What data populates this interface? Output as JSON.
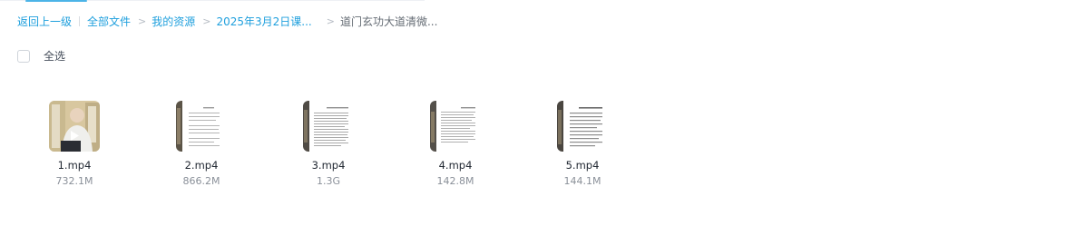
{
  "breadcrumb": {
    "back": "返回上一级",
    "items": [
      "全部文件",
      "我的资源",
      "2025年3月2日课..."
    ],
    "current": "道门玄功大道清微..."
  },
  "select_all_label": "全选",
  "files": [
    {
      "name": "1.mp4",
      "size": "732.1M",
      "thumb": "video-person-icon"
    },
    {
      "name": "2.mp4",
      "size": "866.2M",
      "thumb": "video-document-icon"
    },
    {
      "name": "3.mp4",
      "size": "1.3G",
      "thumb": "video-document-icon"
    },
    {
      "name": "4.mp4",
      "size": "142.8M",
      "thumb": "video-document-icon"
    },
    {
      "name": "5.mp4",
      "size": "144.1M",
      "thumb": "video-document-icon"
    }
  ],
  "colors": {
    "link": "#1e9fdd",
    "accent": "#4cb4e7",
    "text": "#222933",
    "muted": "#8a9099"
  }
}
